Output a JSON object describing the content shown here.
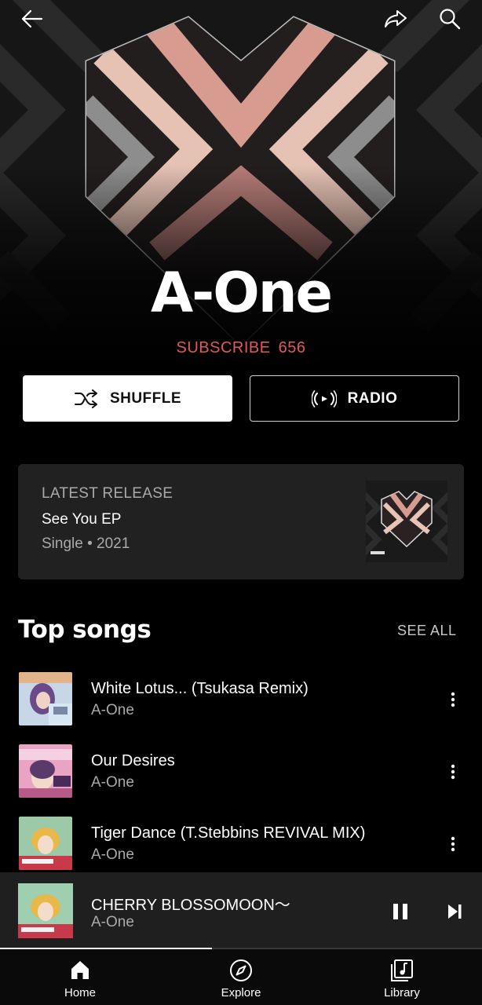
{
  "header": {
    "back_icon": "arrow-left-icon",
    "share_icon": "share-icon",
    "search_icon": "search-icon"
  },
  "artist": {
    "name": "A-One",
    "subscribe_label": "SUBSCRIBE",
    "subscriber_count": "656"
  },
  "actions": {
    "shuffle_label": "SHUFFLE",
    "radio_label": "RADIO"
  },
  "latest_release": {
    "label": "LATEST RELEASE",
    "title": "See You EP",
    "meta": "Single • 2021"
  },
  "top_songs": {
    "title": "Top songs",
    "see_all_label": "SEE ALL",
    "items": [
      {
        "title": "White Lotus... (Tsukasa Remix)",
        "artist": "A-One"
      },
      {
        "title": "Our Desires",
        "artist": "A-One"
      },
      {
        "title": "Tiger Dance (T.Stebbins REVIVAL MIX)",
        "artist": "A-One"
      }
    ]
  },
  "now_playing": {
    "title": "CHERRY BLOSSOMOON～",
    "artist": "A-One",
    "progress": 0.44
  },
  "bottom_nav": {
    "items": [
      {
        "label": "Home",
        "icon": "home-icon",
        "active": true
      },
      {
        "label": "Explore",
        "icon": "compass-icon",
        "active": false
      },
      {
        "label": "Library",
        "icon": "library-icon",
        "active": false
      }
    ]
  },
  "colors": {
    "subscribe": "#e05a5a",
    "card": "#212121",
    "player": "#1f1f1f"
  }
}
